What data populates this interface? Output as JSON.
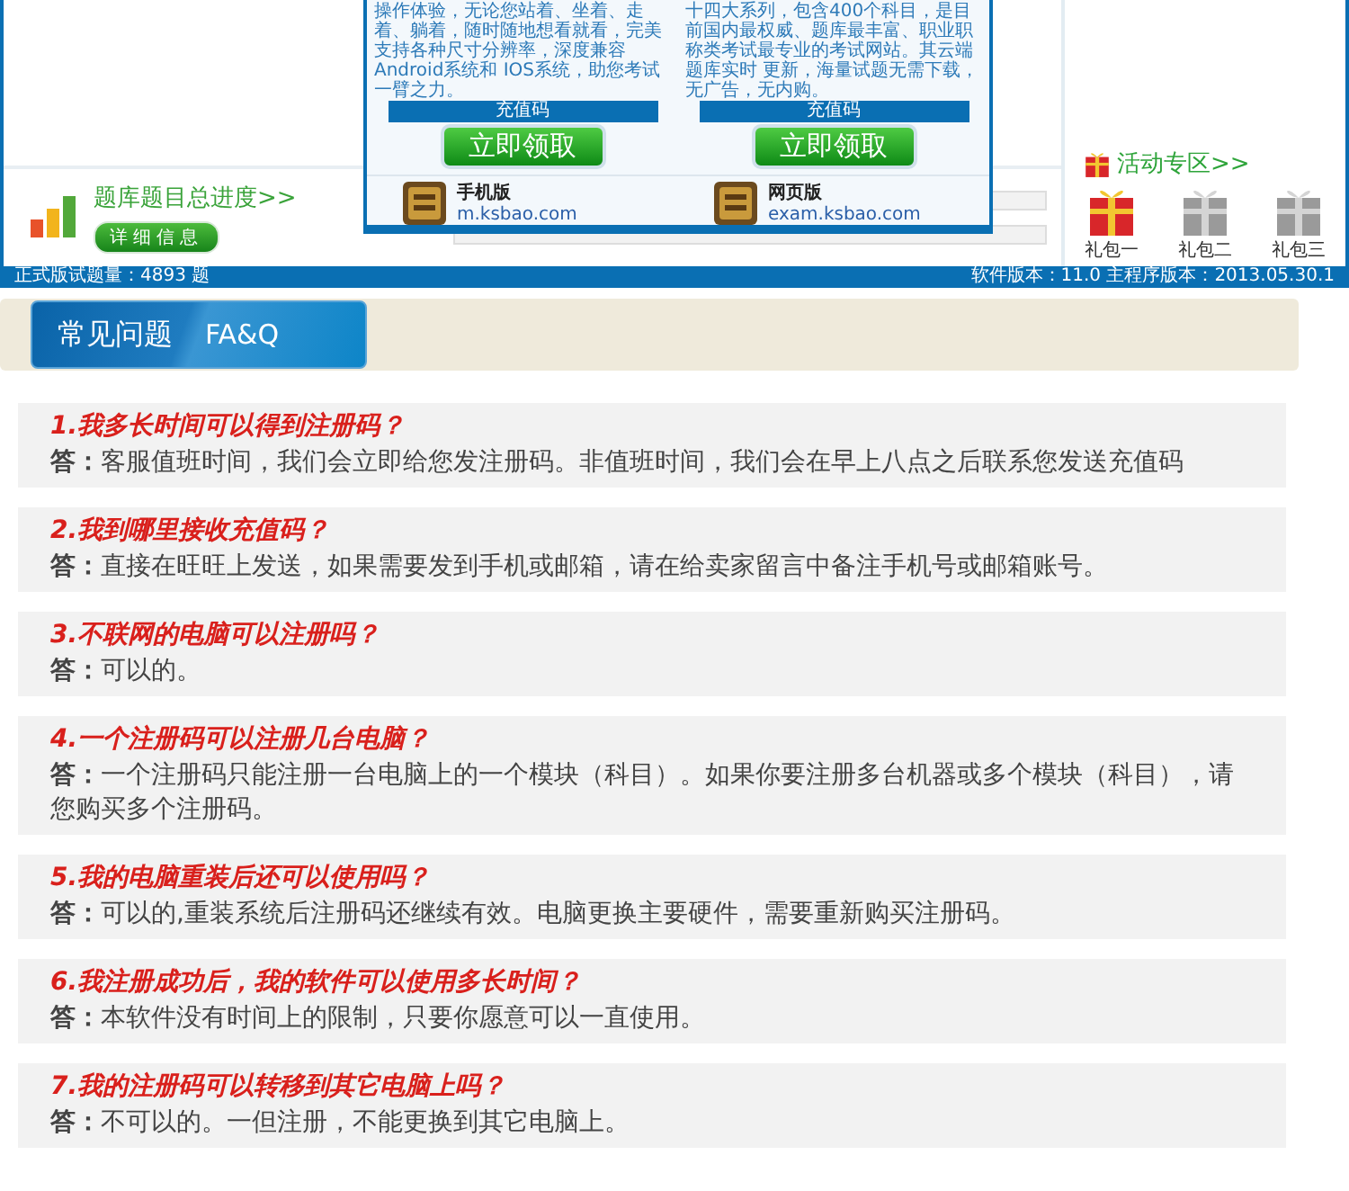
{
  "software_screenshot": {
    "popup": {
      "columns": [
        {
          "description": "操作体验，无论您站着、坐着、走着、躺着，随时随地想看就看，完美支持各种尺寸分辨率，深度兼容Android系统和 IOS系统，助您考试一臂之力。",
          "code_bar": "充值码",
          "claim_button": "立即领取",
          "edition": "手机版",
          "url": "m.ksbao.com"
        },
        {
          "description": "十四大系列，包含400个科目，是目前国内最权威、题库最丰富、职业职称类考试最专业的考试网站。其云端题库实时 更新，海量试题无需下载，无广告，无内购。",
          "code_bar": "充值码",
          "claim_button": "立即领取",
          "edition": "网页版",
          "url": "exam.ksbao.com"
        }
      ]
    },
    "progress": {
      "title": "题库题目总进度>>",
      "details_button": "详细信息"
    },
    "activity": {
      "title": "活动专区>>",
      "gifts": [
        {
          "label": "礼包一",
          "active": true
        },
        {
          "label": "礼包二",
          "active": false
        },
        {
          "label": "礼包三",
          "active": false
        }
      ]
    },
    "status_bar": {
      "question_count": "正式版试题量：4893 题",
      "version": "软件版本：11.0 主程序版本：2013.05.30.1"
    }
  },
  "faq": {
    "title": "常见问题",
    "subtitle": "FA&Q",
    "items": [
      {
        "question": "1.我多长时间可以得到注册码？",
        "answer": "**答：**客服值班时间，我们会立即给您发注册码。非值班时间，我们会在早上八点之后联系您发送充值码"
      },
      {
        "question": "2.我到哪里接收充值码？",
        "answer": "**答：**直接在旺旺上发送，如果需要发到手机或邮箱，请在给卖家留言中备注手机号或邮箱账号。"
      },
      {
        "question": "3.不联网的电脑可以注册吗？",
        "answer": "**答：**可以的。"
      },
      {
        "question": "4.一个注册码可以注册几台电脑？",
        "answer": "**答：**一个注册码只能注册一台电脑上的一个模块（科目）。如果你要注册多台机器或多个模块（科目），请您购买多个注册码。"
      },
      {
        "question": "5.我的电脑重装后还可以使用吗？",
        "answer": "**答：**可以的,重装系统后注册码还继续有效。电脑更换主要硬件，需要重新购买注册码。"
      },
      {
        "question": "6.我注册成功后，我的软件可以使用多长时间？",
        "answer": "**答：**本软件没有时间上的限制，只要你愿意可以一直使用。"
      },
      {
        "question": "7.我的注册码可以转移到其它电脑上吗？",
        "answer": "**答：**不可以的。一但注册，不能更换到其它电脑上。"
      }
    ]
  }
}
